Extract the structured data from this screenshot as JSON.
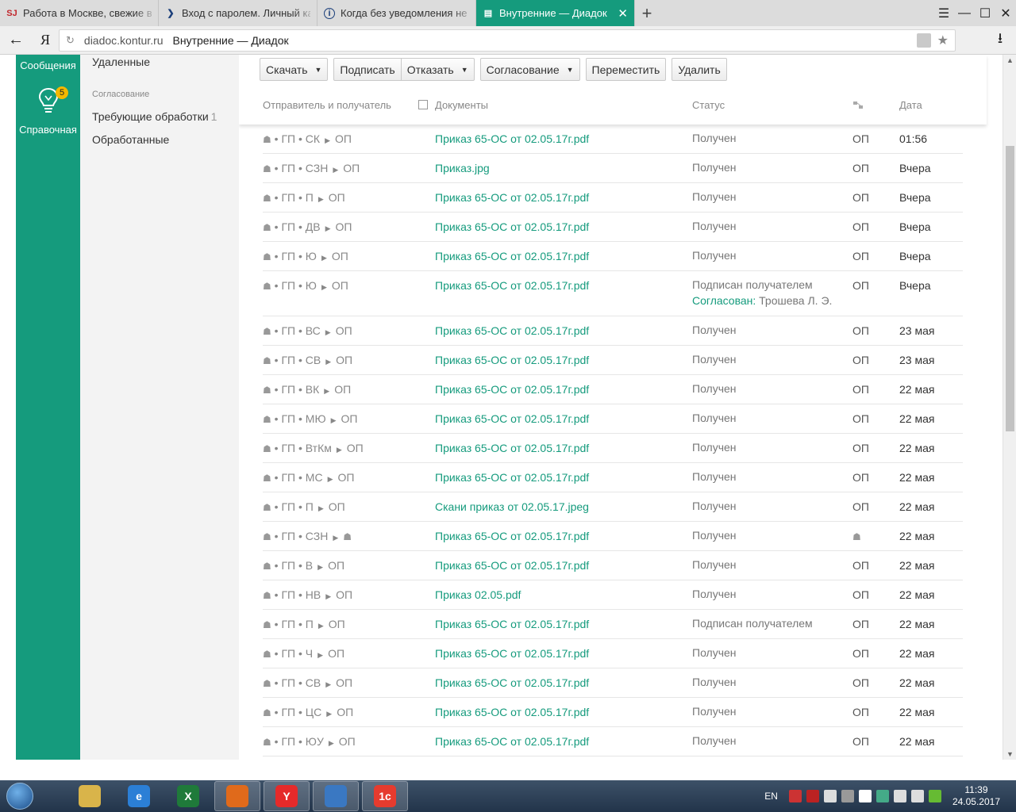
{
  "browser": {
    "tabs": [
      {
        "label": "Работа в Москве, свежие в",
        "favicon": "SJ",
        "active": false
      },
      {
        "label": "Вход с паролем. Личный ка",
        "favicon": "❯",
        "active": false
      },
      {
        "label": "Когда без уведомления не",
        "favicon": "i",
        "active": false
      },
      {
        "label": "Внутренние — Диадок",
        "favicon": "▤",
        "active": true
      }
    ],
    "new_tab": "+",
    "window_controls": {
      "menu": "☰",
      "minimize": "—",
      "maximize": "☐",
      "close": "✕"
    },
    "back": "←",
    "yandex": "Я",
    "domain": "diadoc.kontur.ru",
    "page_title": "Внутренние — Диадок",
    "reload_icon": "↻",
    "star": "★",
    "download": "⭳"
  },
  "appnav": {
    "messages_label": "Сообщения",
    "help_badge": "5",
    "help_label": "Справочная",
    "accent": "#159b7d"
  },
  "folders": {
    "deleted": "Удаленные",
    "section": "Согласование",
    "requires_processing": "Требующие обработки",
    "requires_count": "1",
    "processed": "Обработанные"
  },
  "toolbar": {
    "download": "Скачать",
    "sign": "Подписать",
    "reject": "Отказать",
    "approval": "Согласование",
    "move": "Переместить",
    "delete": "Удалить"
  },
  "columns": {
    "sender": "Отправитель и получатель",
    "documents": "Документы",
    "status": "Статус",
    "date": "Дата"
  },
  "rows": [
    {
      "from": "ГП",
      "sub": "СК",
      "to": "ОП",
      "doc": "Приказ 65-ОС от 02.05.17г.pdf",
      "status": "Получен",
      "org": "ОП",
      "date": "01:56"
    },
    {
      "from": "ГП",
      "sub": "СЗН",
      "to": "ОП",
      "doc": "Приказ.jpg",
      "status": "Получен",
      "org": "ОП",
      "date": "Вчера"
    },
    {
      "from": "ГП",
      "sub": "П",
      "to": "ОП",
      "doc": "Приказ 65-ОС от 02.05.17г.pdf",
      "status": "Получен",
      "org": "ОП",
      "date": "Вчера"
    },
    {
      "from": "ГП",
      "sub": "ДВ",
      "to": "ОП",
      "doc": "Приказ 65-ОС от 02.05.17г.pdf",
      "status": "Получен",
      "org": "ОП",
      "date": "Вчера"
    },
    {
      "from": "ГП",
      "sub": "Ю",
      "to": "ОП",
      "doc": "Приказ 65-ОС от 02.05.17г.pdf",
      "status": "Получен",
      "org": "ОП",
      "date": "Вчера"
    },
    {
      "from": "ГП",
      "sub": "Ю",
      "to": "ОП",
      "doc": "Приказ 65-ОС от 02.05.17г.pdf",
      "status": "Подписан получателем",
      "agree_label": "Согласован:",
      "agree_name": " Трошева Л. Э.",
      "org": "ОП",
      "date": "Вчера"
    },
    {
      "from": "ГП",
      "sub": "ВС",
      "to": "ОП",
      "doc": "Приказ 65-ОС от 02.05.17г.pdf",
      "status": "Получен",
      "org": "ОП",
      "date": "23 мая"
    },
    {
      "from": "ГП",
      "sub": "СВ",
      "to": "ОП",
      "doc": "Приказ 65-ОС от 02.05.17г.pdf",
      "status": "Получен",
      "org": "ОП",
      "date": "23 мая"
    },
    {
      "from": "ГП",
      "sub": "ВК",
      "to": "ОП",
      "doc": "Приказ 65-ОС от 02.05.17г.pdf",
      "status": "Получен",
      "org": "ОП",
      "date": "22 мая"
    },
    {
      "from": "ГП",
      "sub": "МЮ",
      "to": "ОП",
      "doc": "Приказ 65-ОС от 02.05.17г.pdf",
      "status": "Получен",
      "org": "ОП",
      "date": "22 мая"
    },
    {
      "from": "ГП",
      "sub": "ВтКм",
      "to": "ОП",
      "doc": "Приказ 65-ОС от 02.05.17г.pdf",
      "status": "Получен",
      "org": "ОП",
      "date": "22 мая"
    },
    {
      "from": "ГП",
      "sub": "МС",
      "to": "ОП",
      "doc": "Приказ 65-ОС от 02.05.17г.pdf",
      "status": "Получен",
      "org": "ОП",
      "date": "22 мая"
    },
    {
      "from": "ГП",
      "sub": "П",
      "to": "ОП",
      "doc": "Скани приказ от 02.05.17.jpeg",
      "status": "Получен",
      "org": "ОП",
      "date": "22 мая"
    },
    {
      "from": "ГП",
      "sub": "СЗН",
      "to": "",
      "doc": "Приказ 65-ОС от 02.05.17г.pdf",
      "status": "Получен",
      "org": "",
      "date": "22 мая"
    },
    {
      "from": "ГП",
      "sub": "В",
      "to": "ОП",
      "doc": "Приказ 65-ОС от 02.05.17г.pdf",
      "status": "Получен",
      "org": "ОП",
      "date": "22 мая"
    },
    {
      "from": "ГП",
      "sub": "НВ",
      "to": "ОП",
      "doc": "Приказ 02.05.pdf",
      "status": "Получен",
      "org": "ОП",
      "date": "22 мая"
    },
    {
      "from": "ГП",
      "sub": "П",
      "to": "ОП",
      "doc": "Приказ 65-ОС от 02.05.17г.pdf",
      "status": "Подписан получателем",
      "org": "ОП",
      "date": "22 мая"
    },
    {
      "from": "ГП",
      "sub": "Ч",
      "to": "ОП",
      "doc": "Приказ 65-ОС от 02.05.17г.pdf",
      "status": "Получен",
      "org": "ОП",
      "date": "22 мая"
    },
    {
      "from": "ГП",
      "sub": "СВ",
      "to": "ОП",
      "doc": "Приказ 65-ОС от 02.05.17г.pdf",
      "status": "Получен",
      "org": "ОП",
      "date": "22 мая"
    },
    {
      "from": "ГП",
      "sub": "ЦС",
      "to": "ОП",
      "doc": "Приказ 65-ОС от 02.05.17г.pdf",
      "status": "Получен",
      "org": "ОП",
      "date": "22 мая"
    },
    {
      "from": "ГП",
      "sub": "ЮУ",
      "to": "ОП",
      "doc": "Приказ 65-ОС от 02.05.17г.pdf",
      "status": "Получен",
      "org": "ОП",
      "date": "22 мая"
    }
  ],
  "taskbar": {
    "apps": [
      {
        "icon": "folder-icon",
        "label": "",
        "color": "#d9b44a"
      },
      {
        "icon": "ie-icon",
        "label": "e",
        "color": "#2b7fd6"
      },
      {
        "icon": "excel-icon",
        "label": "X",
        "color": "#1f7a3a"
      },
      {
        "icon": "firefox-icon",
        "label": "",
        "color": "#e06a1b"
      },
      {
        "icon": "yandex-browser-icon",
        "label": "Y",
        "color": "#e52a2a"
      },
      {
        "icon": "mail-icon",
        "label": "",
        "color": "#3a78c2"
      },
      {
        "icon": "1c-icon",
        "label": "1с",
        "color": "#e63b2e"
      }
    ],
    "lang": "EN",
    "time": "11:39",
    "date": "24.05.2017"
  }
}
